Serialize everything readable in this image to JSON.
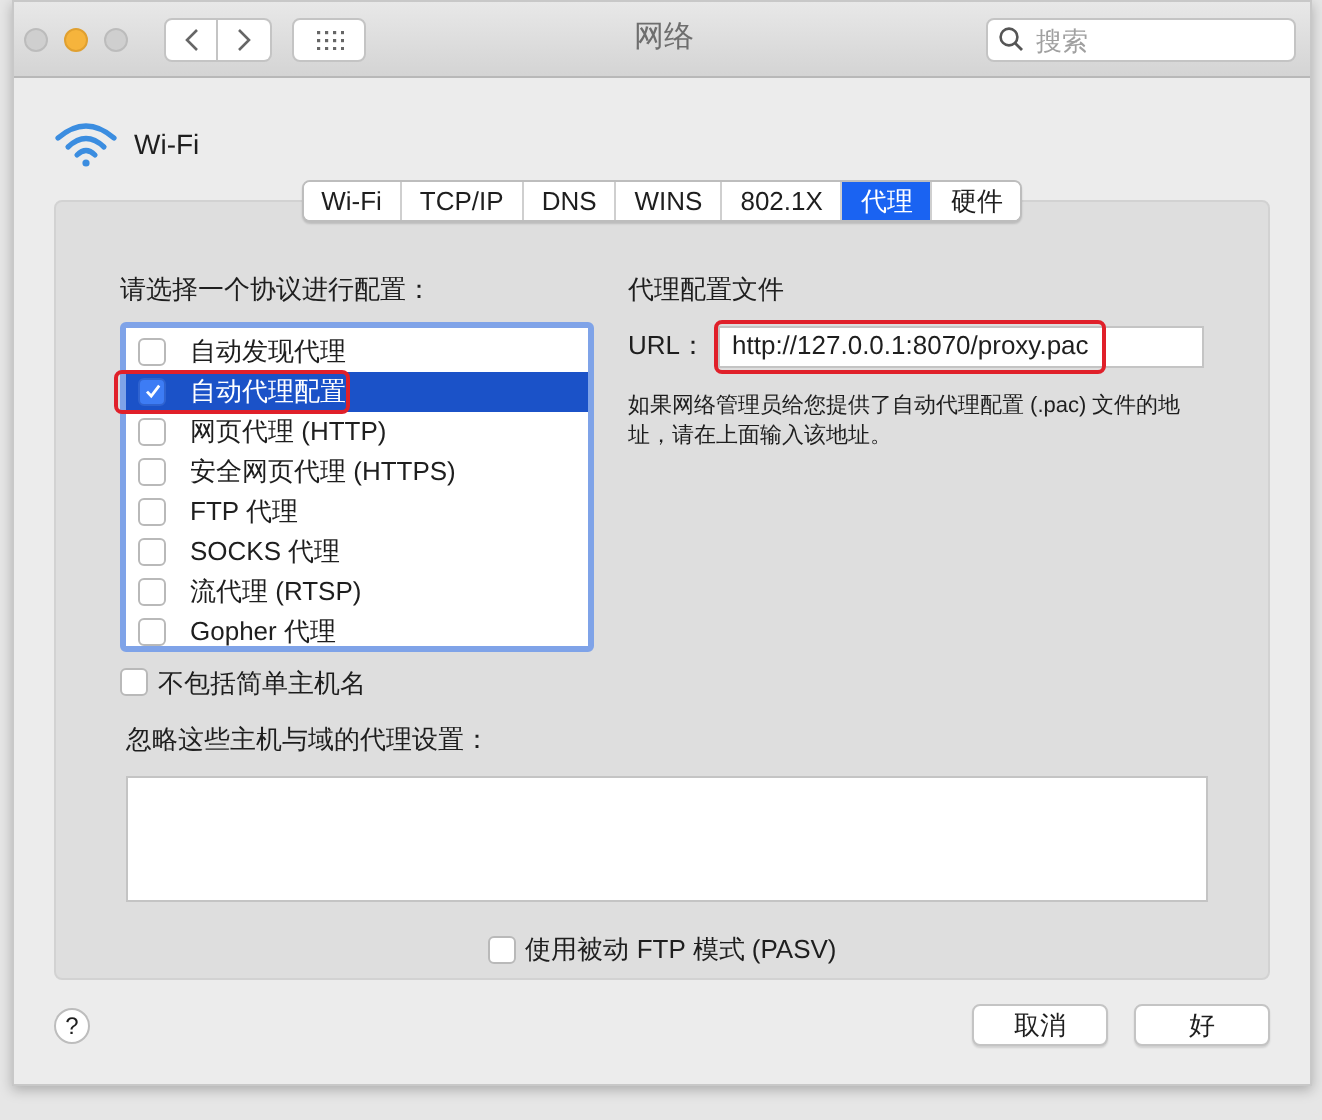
{
  "window": {
    "title": "网络"
  },
  "search": {
    "placeholder": "搜索"
  },
  "service": {
    "name": "Wi-Fi"
  },
  "tabs": [
    {
      "label": "Wi-Fi",
      "selected": false
    },
    {
      "label": "TCP/IP",
      "selected": false
    },
    {
      "label": "DNS",
      "selected": false
    },
    {
      "label": "WINS",
      "selected": false
    },
    {
      "label": "802.1X",
      "selected": false
    },
    {
      "label": "代理",
      "selected": true
    },
    {
      "label": "硬件",
      "selected": false
    }
  ],
  "protocols": {
    "label": "请选择一个协议进行配置：",
    "items": [
      {
        "label": "自动发现代理",
        "checked": false,
        "selected": false,
        "highlighted": false
      },
      {
        "label": "自动代理配置",
        "checked": true,
        "selected": true,
        "highlighted": true
      },
      {
        "label": "网页代理 (HTTP)",
        "checked": false,
        "selected": false,
        "highlighted": false
      },
      {
        "label": "安全网页代理 (HTTPS)",
        "checked": false,
        "selected": false,
        "highlighted": false
      },
      {
        "label": "FTP 代理",
        "checked": false,
        "selected": false,
        "highlighted": false
      },
      {
        "label": "SOCKS 代理",
        "checked": false,
        "selected": false,
        "highlighted": false
      },
      {
        "label": "流代理 (RTSP)",
        "checked": false,
        "selected": false,
        "highlighted": false
      },
      {
        "label": "Gopher 代理",
        "checked": false,
        "selected": false,
        "highlighted": false
      }
    ]
  },
  "exclude_simple_hostnames": {
    "label": "不包括简单主机名",
    "checked": false
  },
  "bypass": {
    "label": "忽略这些主机与域的代理设置："
  },
  "proxy_file": {
    "title": "代理配置文件",
    "url_label": "URL：",
    "url": "http://127.0.0.1:8070/proxy.pac",
    "highlighted": true,
    "help": "如果网络管理员给您提供了自动代理配置 (.pac) 文件的地址，请在上面输入该地址。"
  },
  "passive_ftp": {
    "label": "使用被动 FTP 模式 (PASV)",
    "checked": false
  },
  "help_button": {
    "label": "?"
  },
  "buttons": [
    {
      "label": "取消"
    },
    {
      "label": "好"
    }
  ]
}
